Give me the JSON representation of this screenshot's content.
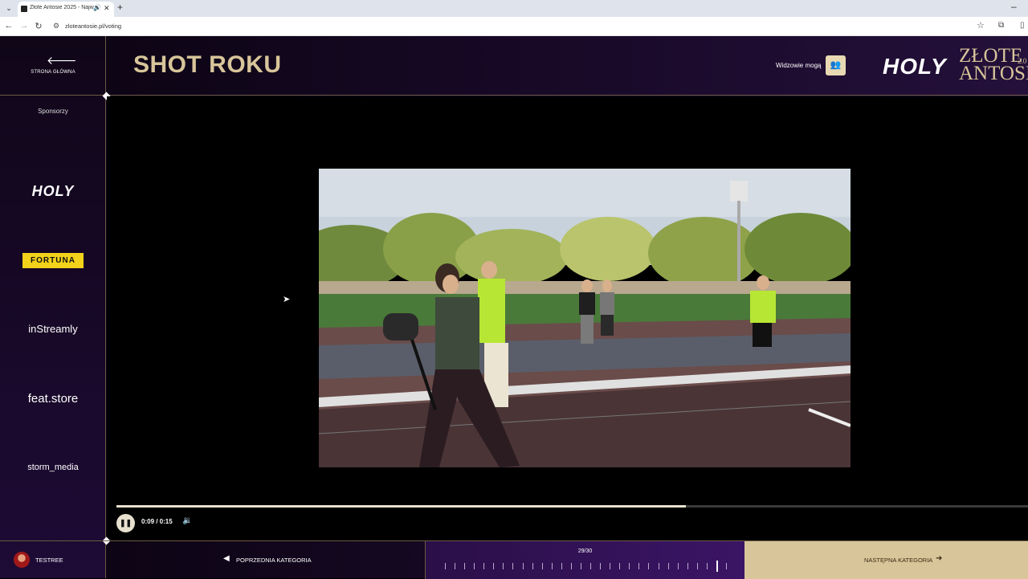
{
  "browser": {
    "tab_title": "Złote Antosie 2025 - Najwi",
    "url": "zloteantosie.pl/voting"
  },
  "sidebar": {
    "home_label": "STRONA GŁÓWNA",
    "sponsors_label": "Sponsorzy",
    "sponsors": [
      "HOLY",
      "FORTUNA",
      "inStreamly",
      "feat.store",
      "storm_media"
    ]
  },
  "header": {
    "category_title": "SHOT ROKU",
    "viewers_label": "Widzowie mogą",
    "brand_holy": "HOLY",
    "brand_zlote": "ZŁOTE",
    "brand_antosie": "ANTOSI",
    "brand_year": "2.0"
  },
  "player": {
    "time": "0:09 / 0:15",
    "progress": 0.625
  },
  "footer": {
    "username": "TESTREE",
    "prev_label": "POPRZEDNIA KATEGORIA",
    "counter": "29/30",
    "current": 29,
    "total": 30,
    "next_label": "NASTĘPNA KATEGORIA"
  },
  "icons": {
    "home": "arrow-left-icon",
    "viewers": "users-icon",
    "play": "pause-icon",
    "volume": "volume-icon"
  }
}
